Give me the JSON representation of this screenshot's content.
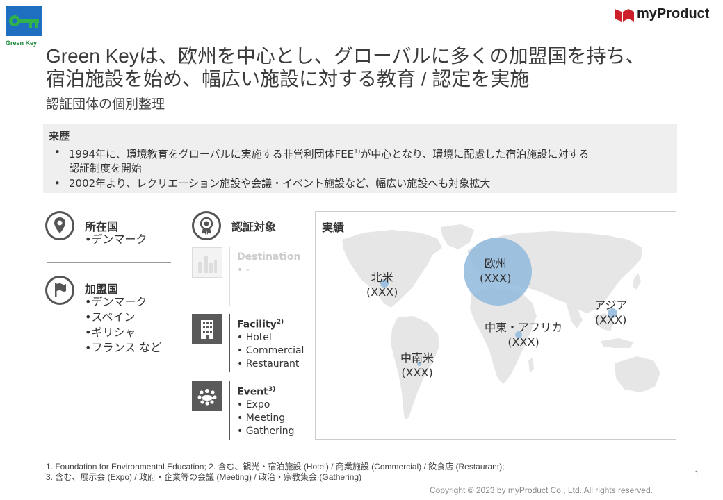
{
  "logo": {
    "caption": "Green Key"
  },
  "brand": {
    "name": "myProduct"
  },
  "title": {
    "line1": "Green Keyは、欧州を中心とし、グローバルに多くの加盟国を持ち、",
    "line2": "宿泊施設を始め、幅広い施設に対する教育 / 認定を実施",
    "subtitle": "認証団体の個別整理"
  },
  "history": {
    "heading": "来歴",
    "items": [
      {
        "text": "1994年に、環境教育をグローバルに実施する非営利団体FEE",
        "sup": "1)",
        "text2": "が中心となり、環境に配慮した宿泊施設に対する",
        "text3": "認証制度を開始"
      },
      {
        "text": "2002年より、レクリエーション施設や会議・イベント施設など、幅広い施設へも対象拡大"
      }
    ]
  },
  "location": {
    "label": "所在国",
    "items": [
      "•デンマーク"
    ]
  },
  "members": {
    "label": "加盟国",
    "items": [
      "•デンマーク",
      "•スペイン",
      "•ギリシャ",
      "•フランス など"
    ]
  },
  "certification": {
    "label": "認証対象",
    "categories": [
      {
        "title": "Destination",
        "sup": "",
        "items": [
          "• -"
        ],
        "faded": true,
        "icon": "city-icon"
      },
      {
        "title": "Facility",
        "sup": "2)",
        "items": [
          "• Hotel",
          "• Commercial",
          "• Restaurant"
        ],
        "faded": false,
        "icon": "building-icon"
      },
      {
        "title": "Event",
        "sup": "3)",
        "items": [
          "• Expo",
          "• Meeting",
          "• Gathering"
        ],
        "faded": false,
        "icon": "group-icon"
      }
    ]
  },
  "results": {
    "label": "実績",
    "regions": [
      {
        "name": "北米",
        "value": "(XXX)"
      },
      {
        "name": "欧州",
        "value": "(XXX)"
      },
      {
        "name": "アジア",
        "value": "(XXX)"
      },
      {
        "name": "中東・アフリカ",
        "value": "(XXX)"
      },
      {
        "name": "中南米",
        "value": "(XXX)"
      }
    ]
  },
  "footnotes": {
    "line1": "1. Foundation for Environmental Education; 2. 含む、観光・宿泊施設 (Hotel) / 商業施設 (Commercial) / 飲食店 (Restaurant);",
    "line2": "3. 含む、展示会 (Expo) / 政府・企業等の会議 (Meeting) / 政治・宗教集会 (Gathering)"
  },
  "page_number": "1",
  "copyright": "Copyright © 2023 by myProduct Co., Ltd.  All rights reserved.",
  "colors": {
    "green_key": "#1a8a3c",
    "green_key_blue": "#1e6fbf",
    "bubble": "#8fb8dc",
    "map_land": "#e6e6e6",
    "brand_red": "#cc1f2a"
  }
}
